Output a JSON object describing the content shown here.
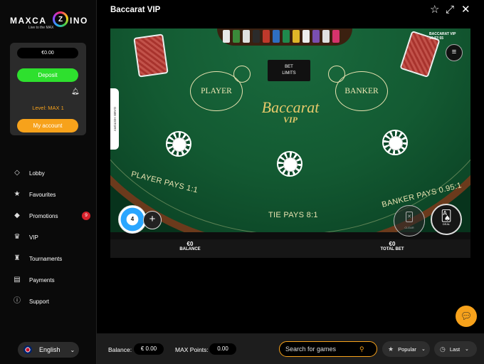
{
  "brand": {
    "logo_left": "MAXCA",
    "logo_mid": "Z",
    "logo_right": "INO",
    "tagline": "Live to the MAX"
  },
  "wallet": {
    "balance": "€0.00",
    "deposit_label": "Deposit",
    "level": "Level: MAX 1",
    "account_label": "My account"
  },
  "nav": {
    "items": [
      {
        "label": "Lobby",
        "icon": "diamond-icon"
      },
      {
        "label": "Favourites",
        "icon": "star-icon"
      },
      {
        "label": "Promotions",
        "icon": "tag-icon",
        "badge": "9"
      },
      {
        "label": "VIP",
        "icon": "crown-icon"
      },
      {
        "label": "Tournaments",
        "icon": "trophy-icon"
      },
      {
        "label": "Payments",
        "icon": "wallet-icon"
      },
      {
        "label": "Support",
        "icon": "info-icon"
      }
    ]
  },
  "language": {
    "label": "English"
  },
  "header": {
    "title": "Baccarat VIP"
  },
  "game": {
    "timer": "BACCARAT VIP 10:57:55",
    "bet_limits_line1": "BET",
    "bet_limits_line2": "LIMITS",
    "player": "PLAYER",
    "banker": "BANKER",
    "brand_name": "Baccarat",
    "brand_sub": "VIP",
    "player_pays": "PLAYER PAYS 1:1",
    "tie_pays": "TIE PAYS 8:1",
    "banker_pays": "BANKER PAYS 0.95:1",
    "game_history": "GAME HISTORY",
    "chip_value": "4",
    "clear_label": "CLEAR",
    "deal_label": "DEAL",
    "balance_value": "€0",
    "balance_label": "BALANCE",
    "total_bet_value": "€0",
    "total_bet_label": "TOTAL BET"
  },
  "bottombar": {
    "balance_label": "Balance:",
    "balance_value": "€ 0.00",
    "max_points_label": "MAX Points:",
    "max_points_value": "0.00",
    "search_placeholder": "Search for games",
    "sort_label": "Popular",
    "recent_label": "Last"
  },
  "colors": {
    "accent": "#f7a21b",
    "deposit": "#2ee02e",
    "felt": "#135a32",
    "badge": "#d8212b"
  }
}
